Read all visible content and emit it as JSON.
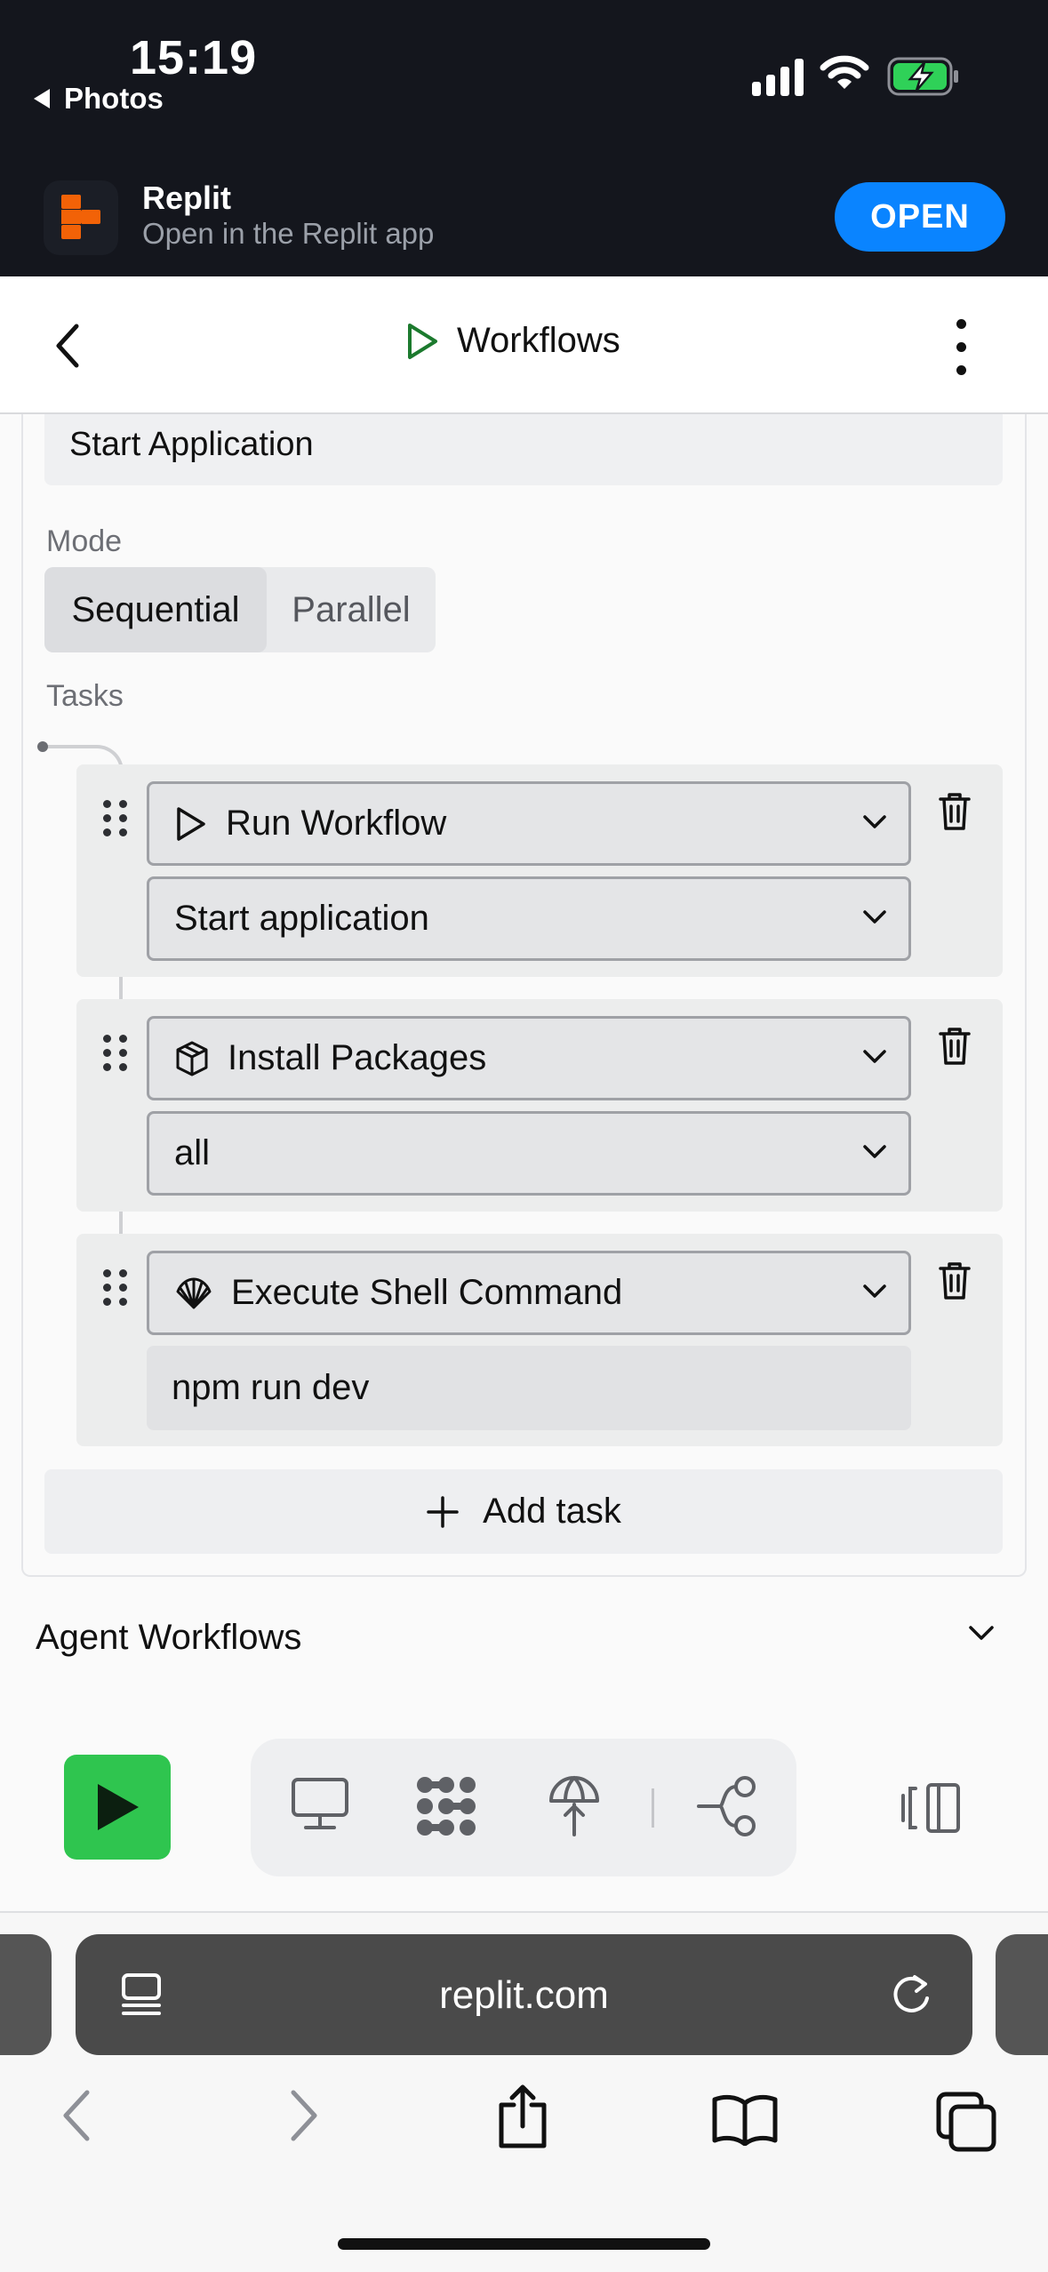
{
  "status_bar": {
    "time": "15:19",
    "back_label": "Photos",
    "icons": [
      "cellular-signal-icon",
      "wifi-icon",
      "battery-charging-icon"
    ]
  },
  "app_banner": {
    "name": "Replit",
    "subtitle": "Open in the Replit app",
    "open_label": "OPEN",
    "accent": "#0a84ff"
  },
  "header": {
    "title": "Workflows",
    "icons": [
      "back-chevron-icon",
      "play-icon",
      "more-vertical-icon"
    ]
  },
  "workflow": {
    "name_value": "Start Application",
    "mode_label": "Mode",
    "modes": [
      "Sequential",
      "Parallel"
    ],
    "selected_mode": "Sequential",
    "tasks_label": "Tasks",
    "tasks": [
      {
        "type": "Run Workflow",
        "icon": "play-icon",
        "argument": "Start application",
        "argument_kind": "select"
      },
      {
        "type": "Install Packages",
        "icon": "package-box-icon",
        "argument": "all",
        "argument_kind": "select"
      },
      {
        "type": "Execute Shell Command",
        "icon": "shell-icon",
        "argument": "npm run dev",
        "argument_kind": "input"
      }
    ],
    "add_task_label": "Add task"
  },
  "agent_section": {
    "label": "Agent Workflows"
  },
  "toolbar": {
    "run_color": "#2fc54f",
    "tools": [
      "monitor-icon",
      "workflows-icon",
      "deploy-icon",
      "git-branch-icon"
    ],
    "layout_icon": "panel-layout-icon"
  },
  "browser": {
    "url": "replit.com",
    "nav": [
      "back-icon",
      "forward-icon",
      "share-icon",
      "bookmarks-icon",
      "tabs-icon"
    ]
  }
}
